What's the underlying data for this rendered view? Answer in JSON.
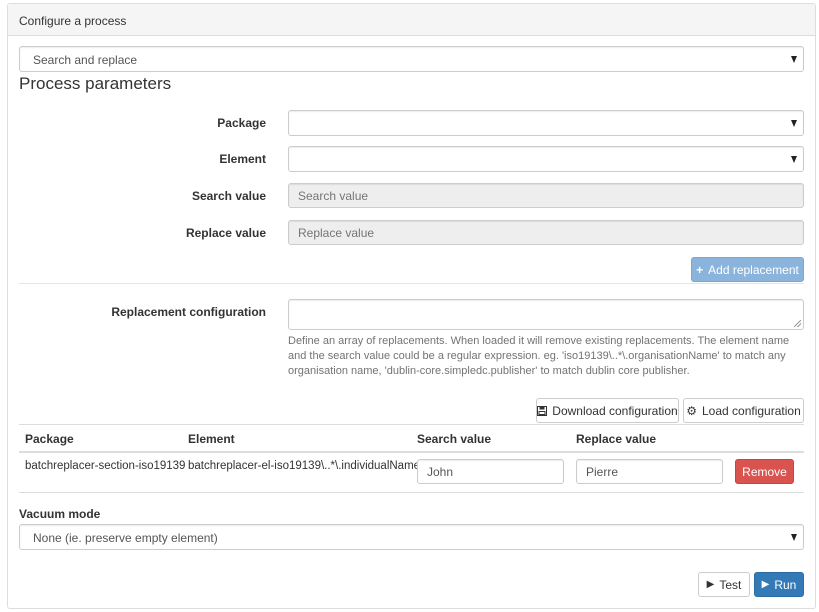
{
  "panel": {
    "title": "Configure a process"
  },
  "process_select": {
    "value": "Search and replace"
  },
  "params": {
    "title": "Process parameters",
    "package_label": "Package",
    "package_value": "",
    "element_label": "Element",
    "element_value": "",
    "search_label": "Search value",
    "search_placeholder": "Search value",
    "replace_label": "Replace value",
    "replace_placeholder": "Replace value",
    "add_replacement": "Add replacement",
    "config_label": "Replacement configuration",
    "config_help": "Define an array of replacements. When loaded it will remove existing replacements. The element name and the search value could be a regular expression. eg. 'iso19139\\..*\\.organisationName' to match any organisation name, 'dublin-core.simpledc.publisher' to match dublin core publisher.",
    "download_config": "Download configuration",
    "load_config": "Load configuration"
  },
  "table": {
    "headers": [
      "Package",
      "Element",
      "Search value",
      "Replace value"
    ],
    "rows": [
      {
        "package": "batchreplacer-section-iso19139",
        "element": "batchreplacer-el-iso19139\\..*\\.individualName",
        "search": "John",
        "replace": "Pierre",
        "remove": "Remove"
      }
    ]
  },
  "vacuum": {
    "label": "Vacuum mode",
    "value": "None (ie. preserve empty element)"
  },
  "actions": {
    "test": "Test",
    "run": "Run"
  },
  "colors": {
    "primary": "#337ab7",
    "primary_disabled": "#8ab4db",
    "danger": "#d9534f",
    "heading_bg": "#f5f5f5"
  }
}
